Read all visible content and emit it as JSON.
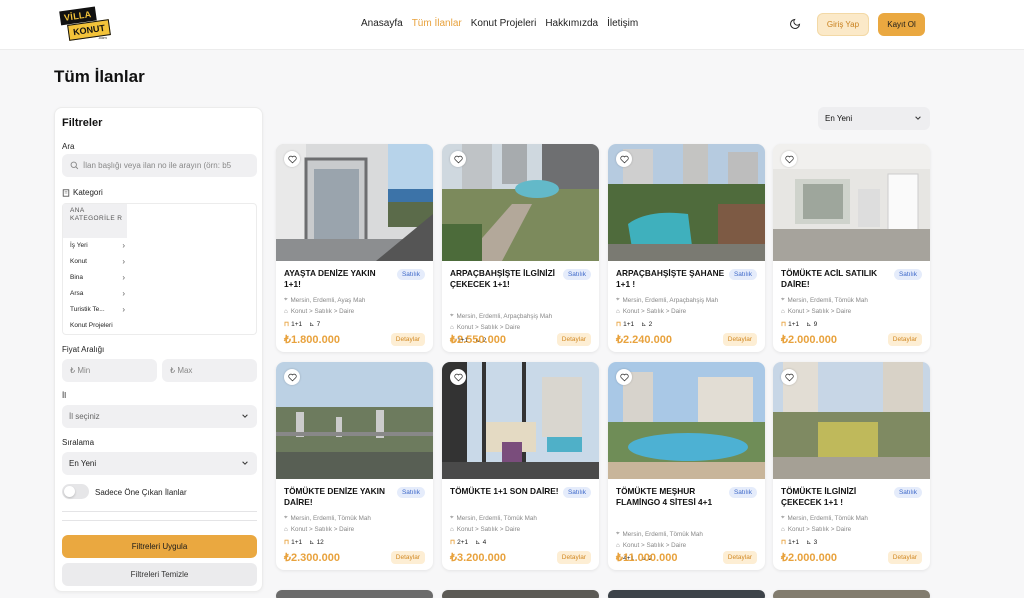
{
  "header": {
    "logo": {
      "line1": "VİLLA",
      "line2": "KONUT",
      "line3": ".com"
    },
    "nav": [
      {
        "label": "Anasayfa",
        "active": false
      },
      {
        "label": "Tüm İlanlar",
        "active": true
      },
      {
        "label": "Konut Projeleri",
        "active": false
      },
      {
        "label": "Hakkımızda",
        "active": false
      },
      {
        "label": "İletişim",
        "active": false
      }
    ],
    "theme_icon": "moon-icon",
    "login_label": "Giriş Yap",
    "register_label": "Kayıt Ol"
  },
  "page": {
    "title": "Tüm İlanlar"
  },
  "sort_top": {
    "value": "En Yeni"
  },
  "filters": {
    "title": "Filtreler",
    "search": {
      "label": "Ara",
      "placeholder": "İlan başlığı veya ilan no ile arayın (örn: b5"
    },
    "category": {
      "label": "Kategori",
      "header": "ANA KATEGORİLE R",
      "items": [
        "İş Yeri",
        "Konut",
        "Bina",
        "Arsa",
        "Turistik Te...",
        "Konut Projeleri"
      ]
    },
    "price": {
      "label": "Fiyat Aralığı",
      "min_placeholder": "₺ Min",
      "max_placeholder": "₺ Max"
    },
    "city": {
      "label": "İl",
      "value": "İl seçiniz"
    },
    "sorting": {
      "label": "Sıralama",
      "value": "En Yeni"
    },
    "featured_toggle": {
      "label": "Sadece Öne Çıkan İlanlar",
      "on": false
    },
    "apply_label": "Filtreleri Uygula",
    "clear_label": "Filtreleri Temizle"
  },
  "listings": [
    {
      "title": "AYAŞTA DENİZE YAKIN 1+1!",
      "badge": "Satılık",
      "location": "Mersin, Erdemli, Ayaş Mah",
      "type": "Konut > Satılık > Daire",
      "rooms": "1+1",
      "floor": "7",
      "price": "₺1.800.000",
      "detail": "Detaylar"
    },
    {
      "title": "ARPAÇBAHŞİŞTE İLGİNİZİ ÇEKECEK 1+1!",
      "badge": "Satılık",
      "location": "Mersin, Erdemli, Arpaçbahşiş Mah",
      "type": "Konut > Satılık > Daire",
      "rooms": "1+1",
      "floor": "2",
      "price": "₺2.550.000",
      "detail": "Detaylar"
    },
    {
      "title": "ARPAÇBAHŞİŞTE ŞAHANE 1+1 !",
      "badge": "Satılık",
      "location": "Mersin, Erdemli, Arpaçbahşiş Mah",
      "type": "Konut > Satılık > Daire",
      "rooms": "1+1",
      "floor": "2",
      "price": "₺2.240.000",
      "detail": "Detaylar"
    },
    {
      "title": "TÖMÜKTE ACİL SATILIK DAİRE!",
      "badge": "Satılık",
      "location": "Mersin, Erdemli, Tömük Mah",
      "type": "Konut > Satılık > Daire",
      "rooms": "1+1",
      "floor": "9",
      "price": "₺2.000.000",
      "detail": "Detaylar"
    },
    {
      "title": "TÖMÜKTE DENİZE YAKIN DAİRE!",
      "badge": "Satılık",
      "location": "Mersin, Erdemli, Tömük Mah",
      "type": "Konut > Satılık > Daire",
      "rooms": "1+1",
      "floor": "12",
      "price": "₺2.300.000",
      "detail": "Detaylar"
    },
    {
      "title": "TÖMÜKTE 1+1 SON DAİRE!",
      "badge": "Satılık",
      "location": "Mersin, Erdemli, Tömük Mah",
      "type": "Konut > Satılık > Daire",
      "rooms": "2+1",
      "floor": "4",
      "price": "₺3.200.000",
      "detail": "Detaylar"
    },
    {
      "title": "TÖMÜKTE MEŞHUR FLAMİNGO 4 SİTESİ 4+1",
      "badge": "Satılık",
      "location": "Mersin, Erdemli, Tömük Mah",
      "type": "Konut > Satılık > Daire",
      "rooms": "4+1",
      "floor": "2",
      "price": "₺11.000.000",
      "detail": "Detaylar"
    },
    {
      "title": "TÖMÜKTE İLGİNİZİ ÇEKECEK 1+1 !",
      "badge": "Satılık",
      "location": "Mersin, Erdemli, Tömük Mah",
      "type": "Konut > Satılık > Daire",
      "rooms": "1+1",
      "floor": "3",
      "price": "₺2.000.000",
      "detail": "Detaylar"
    }
  ]
}
